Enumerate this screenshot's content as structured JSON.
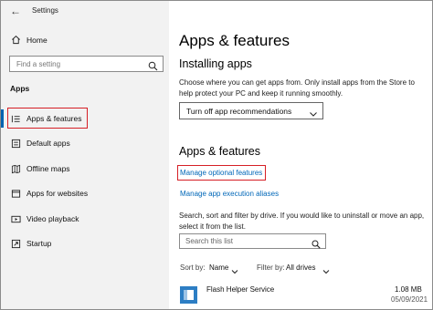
{
  "window": {
    "back_glyph": "←",
    "title": "Settings"
  },
  "sidebar": {
    "home_label": "Home",
    "search_placeholder": "Find a setting",
    "group_label": "Apps",
    "items": [
      {
        "label": "Apps & features",
        "icon": "apps-features-icon",
        "selected": true
      },
      {
        "label": "Default apps",
        "icon": "default-apps-icon"
      },
      {
        "label": "Offline maps",
        "icon": "offline-maps-icon"
      },
      {
        "label": "Apps for websites",
        "icon": "apps-for-websites-icon"
      },
      {
        "label": "Video playback",
        "icon": "video-playback-icon"
      },
      {
        "label": "Startup",
        "icon": "startup-icon"
      }
    ]
  },
  "main": {
    "page_title": "Apps & features",
    "installing": {
      "heading": "Installing apps",
      "description": "Choose where you can get apps from. Only install apps from the Store to help protect your PC and keep it running smoothly.",
      "dropdown_value": "Turn off app recommendations"
    },
    "features": {
      "heading": "Apps & features",
      "link_optional": "Manage optional features",
      "link_aliases": "Manage app execution aliases",
      "description": "Search, sort and filter by drive. If you would like to uninstall or move an app, select it from the list.",
      "search_placeholder": "Search this list",
      "sort_label": "Sort by:",
      "sort_value": "Name",
      "filter_label": "Filter by:",
      "filter_value": "All drives"
    },
    "apps": [
      {
        "name": "Flash Helper Service",
        "size": "1.08 MB",
        "date": "05/09/2021"
      }
    ]
  },
  "colors": {
    "accent": "#0063b1",
    "link": "#0067b8",
    "highlight": "#d61f26"
  }
}
